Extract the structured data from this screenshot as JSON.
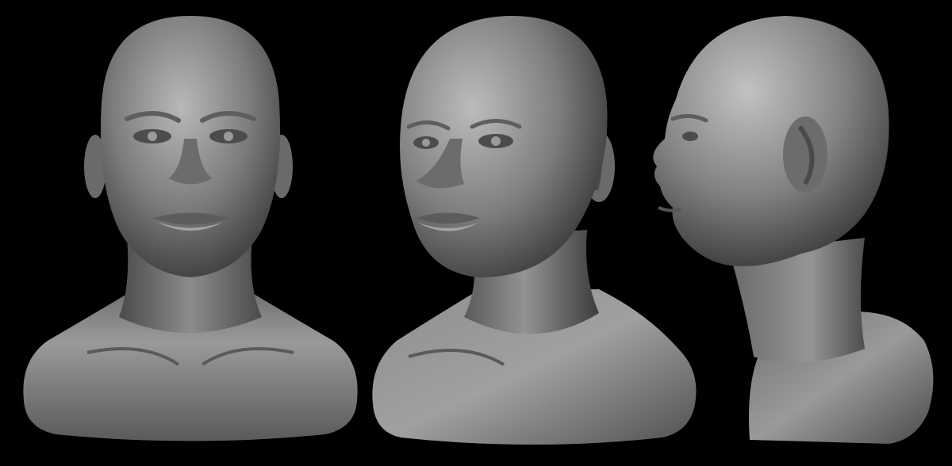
{
  "scene": {
    "background_color": "#000000",
    "material_color": "#8a8a8a",
    "highlight_color": "#c4c4c4",
    "shadow_color": "#2a2a2a",
    "views": [
      {
        "id": "front",
        "name": "front-view"
      },
      {
        "id": "three-quarter",
        "name": "three-quarter-view"
      },
      {
        "id": "profile",
        "name": "profile-view"
      }
    ]
  }
}
